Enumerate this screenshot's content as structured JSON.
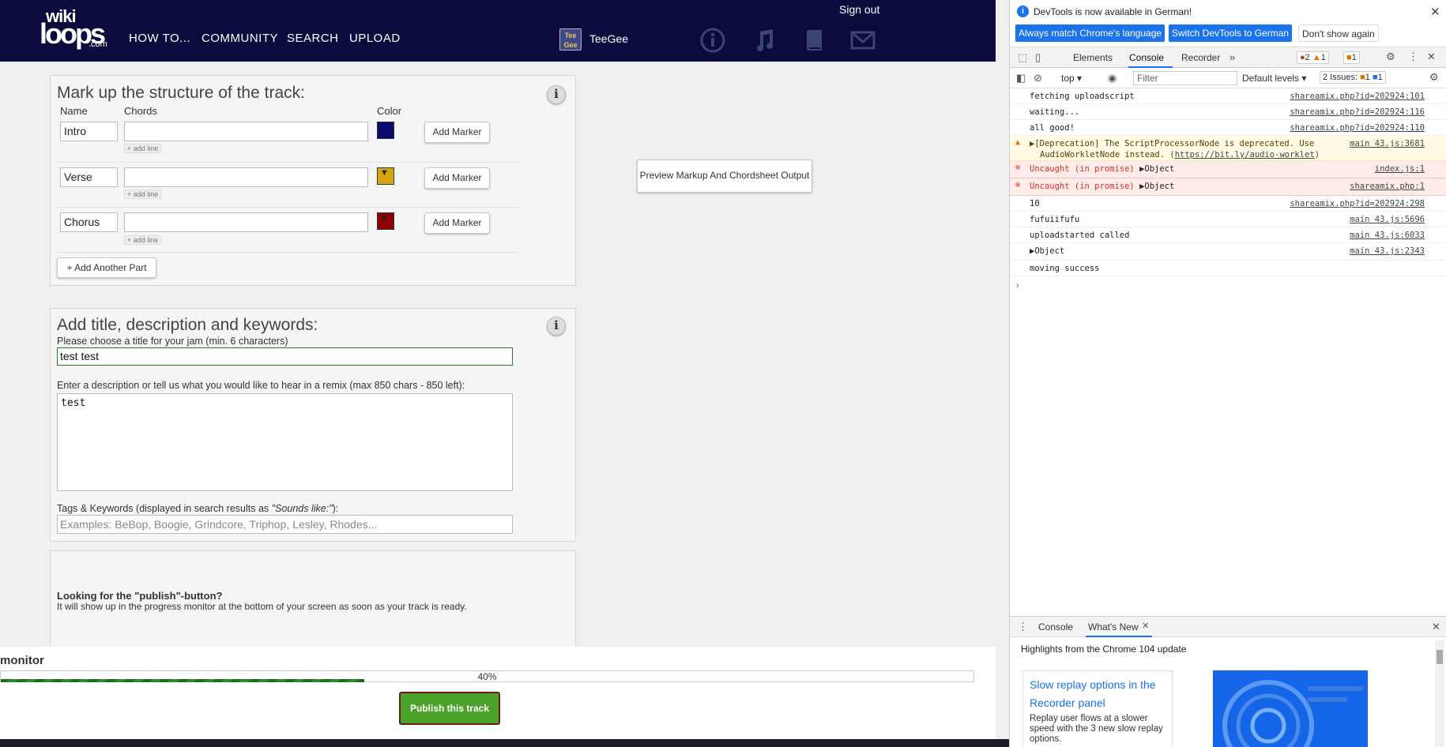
{
  "site": {
    "logo": {
      "line1": "wiki",
      "line2": "loops",
      "line3": ".com"
    },
    "nav": [
      "HOW TO...",
      "COMMUNITY",
      "SEARCH",
      "UPLOAD"
    ],
    "signout": "Sign out",
    "user": {
      "avatar_text": "Tee Gee",
      "name": "TeeGee"
    },
    "nav_icons": [
      "info-icon",
      "music-note-icon",
      "book-icon",
      "mail-icon"
    ]
  },
  "markup": {
    "title": "Mark up the structure of the track:",
    "col_name": "Name",
    "col_chords": "Chords",
    "col_color": "Color",
    "add_line": "+ add line",
    "add_marker": "Add Marker",
    "parts": [
      {
        "name": "Intro",
        "color": "#0a0a6e"
      },
      {
        "name": "Verse",
        "color": "#d4a50c"
      },
      {
        "name": "Chorus",
        "color": "#8b0000"
      }
    ],
    "add_part": "+ Add Another Part"
  },
  "preview_button": "Preview Markup And Chordsheet Output",
  "details": {
    "title": "Add title, description and keywords:",
    "title_label": "Please choose a title for your jam (min. 6 characters)",
    "title_value": "test test",
    "desc_label": "Enter a description or tell us what you would like to hear in a remix (max 850 chars - 850 left):",
    "desc_value": "test",
    "tags_label": "Tags & Keywords (displayed in search results as ",
    "tags_label_em": "\"Sounds like:\"",
    "tags_label_end": "):",
    "tags_placeholder": "Examples: BeBop, Boogie, Grindcore, Triphop, Lesley, Rhodes..."
  },
  "publish_info": {
    "heading": "Looking for the \"publish\"-button?",
    "text": "It will show up in the progress monitor at the bottom of your screen as soon as your track is ready."
  },
  "monitor": {
    "title": "monitor",
    "progress": 0.4,
    "progress_label": "40%",
    "publish": "Publish this track"
  },
  "devtools": {
    "banner": "DevTools is now available in German!",
    "banner_buttons": [
      "Always match Chrome's language",
      "Switch DevTools to German",
      "Don't show again"
    ],
    "tabs": [
      "Elements",
      "Console",
      "Recorder"
    ],
    "errors": "2",
    "warnings": "1",
    "issues_badge": "1",
    "toolbar_context": "top",
    "filter": "Filter",
    "levels": "Default levels",
    "issues": "2 Issues:",
    "issues_warn": "1",
    "issues_info": "1",
    "logs": [
      {
        "level": "info",
        "msg": "fetching uploadscript",
        "src": "shareamix.php?id=202924:101"
      },
      {
        "level": "info",
        "msg": "waiting...",
        "src": "shareamix.php?id=202924:116"
      },
      {
        "level": "info",
        "msg": "all good!",
        "src": "shareamix.php?id=202924:110"
      },
      {
        "level": "warn",
        "msg": "▶[Deprecation] The ScriptProcessorNode is deprecated. Use",
        "msg2": "AudioWorkletNode instead. (",
        "link": "https://bit.ly/audio-worklet",
        "msg3": ")",
        "src": "main 43.js:3681"
      },
      {
        "level": "error",
        "msg": "Uncaught (in promise) ",
        "obj": "▶Object",
        "src": "index.js:1"
      },
      {
        "level": "error",
        "msg": "Uncaught (in promise) ",
        "obj": "▶Object",
        "src": "shareamix.php:1"
      },
      {
        "level": "info",
        "msg": "10",
        "src": "shareamix.php?id=202924:298"
      },
      {
        "level": "info",
        "msg": "fufuiifufu",
        "src": "main 43.js:5696"
      },
      {
        "level": "info",
        "msg": "uploadstarted called",
        "src": "main 43.js:6033"
      },
      {
        "level": "info",
        "msg": "▶Object",
        "src": "main 43.js:2343"
      },
      {
        "level": "info",
        "msg": "moving success",
        "src": ""
      }
    ],
    "prompt": "›",
    "drawer_tabs": [
      "Console",
      "What's New"
    ],
    "drawer_headline": "Highlights from the Chrome 104 update",
    "card_title": "Slow replay options in the Recorder panel",
    "card_desc": "Replay user flows at a slower speed with the 3 new slow replay options."
  },
  "colors": {
    "nav_bg": "#0b0b3d",
    "publish_green": "#4aa328",
    "devtools_accent": "#1a73e8"
  }
}
